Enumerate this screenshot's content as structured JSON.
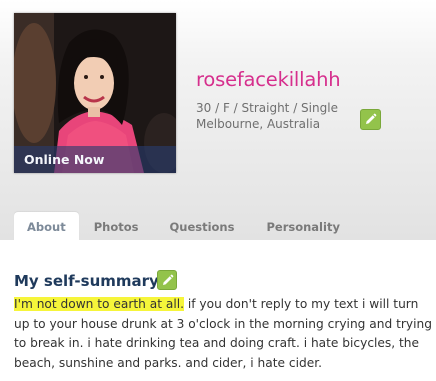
{
  "profile": {
    "username": "rosefacekillahh",
    "details_line1": "30 / F / Straight / Single",
    "details_line2": "Melbourne, Australia",
    "online_status": "Online Now"
  },
  "tabs": [
    {
      "label": "About",
      "active": true
    },
    {
      "label": "Photos",
      "active": false
    },
    {
      "label": "Questions",
      "active": false
    },
    {
      "label": "Personality",
      "active": false
    }
  ],
  "self_summary": {
    "title": "My self-summary",
    "highlighted_text": "I'm not down to earth at all.",
    "rest_text": " if you don't reply to my text i will turn up to your house drunk at 3 o'clock in the morning crying and trying to break in. i hate drinking tea and doing craft. i hate bicycles, the beach, sunshine and parks. and cider, i hate cider."
  },
  "colors": {
    "username": "#d62f8d",
    "section_title": "#1f3a5c",
    "edit_button": "#93c34b",
    "highlight": "#f6f53a"
  },
  "icons": {
    "edit": "pencil-icon"
  }
}
